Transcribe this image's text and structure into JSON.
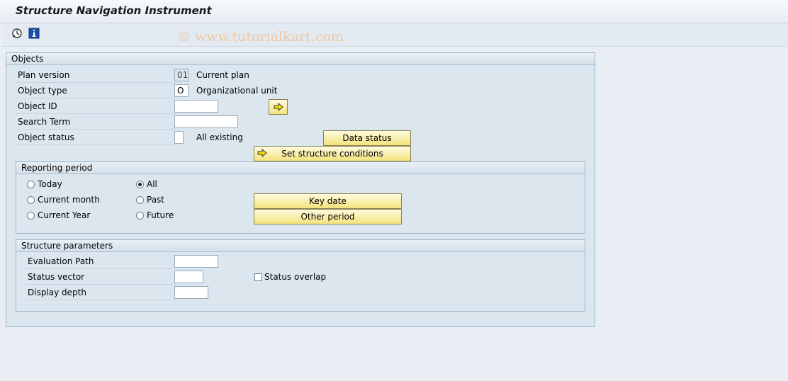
{
  "window": {
    "title": "Structure Navigation Instrument"
  },
  "toolbar": {
    "watermark": "© www.tutorialkart.com"
  },
  "objects": {
    "group_title": "Objects",
    "plan_version": {
      "label": "Plan version",
      "value": "01",
      "desc": "Current plan"
    },
    "object_type": {
      "label": "Object type",
      "value": "O",
      "desc": "Organizational unit"
    },
    "object_id": {
      "label": "Object ID",
      "value": ""
    },
    "search_term": {
      "label": "Search Term",
      "value": ""
    },
    "object_status": {
      "label": "Object status",
      "value": "",
      "desc": "All existing"
    },
    "data_status_label": "Data status",
    "set_structure_label": "Set structure conditions"
  },
  "reporting": {
    "group_title": "Reporting period",
    "options": [
      "Today",
      "Current month",
      "Current Year",
      "All",
      "Past",
      "Future"
    ],
    "selected": "All",
    "key_date_label": "Key date",
    "other_period_label": "Other period"
  },
  "structure": {
    "group_title": "Structure parameters",
    "evaluation_path": {
      "label": "Evaluation Path",
      "value": ""
    },
    "status_vector": {
      "label": "Status vector",
      "value": ""
    },
    "display_depth": {
      "label": "Display depth",
      "value": ""
    },
    "status_overlap_label": "Status overlap",
    "status_overlap_checked": false
  },
  "colors": {
    "button": "#f4e37d",
    "group_background": "#dbe6ef",
    "page_background": "#e8eef4",
    "watermark": "#f0c7a0"
  }
}
